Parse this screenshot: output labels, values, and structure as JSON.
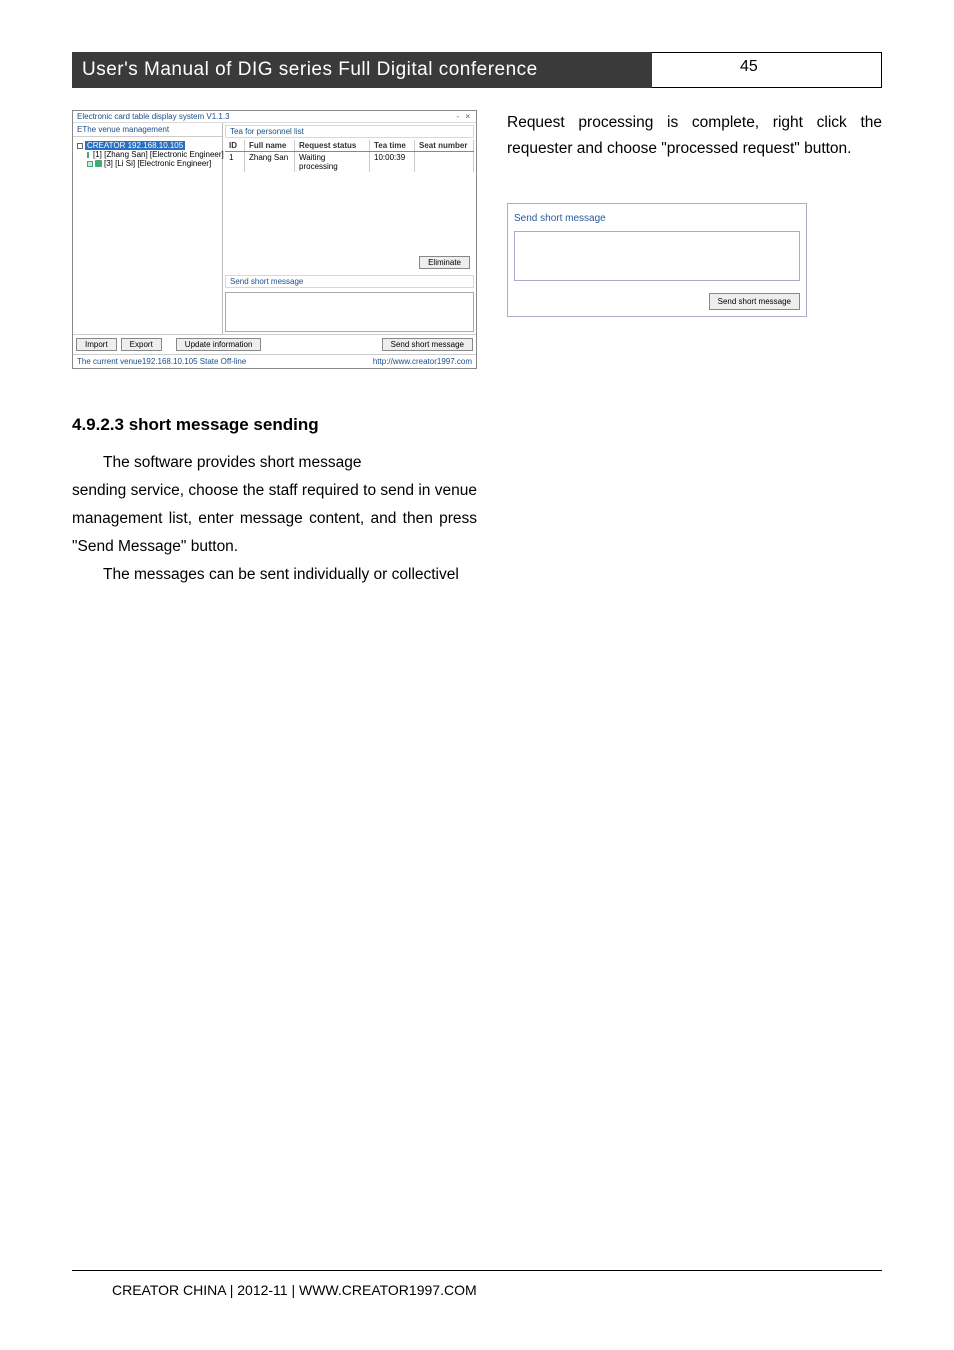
{
  "header": {
    "title": "User's  Manual  of  DIG  series  Full  Digital  conference",
    "page_number": "45"
  },
  "app_window": {
    "title": "Electronic card table display system V1.1.3",
    "tree_header": "EThe venue management",
    "tree": {
      "root_label": "CREATOR 192.168.10.105",
      "items": [
        {
          "label": "[1] [Zhang San] [Electronic Engineer]"
        },
        {
          "label": "[3] [Li Si] [Electronic Engineer]"
        }
      ]
    },
    "panel1_header": "Tea for personnel list",
    "grid_headers": {
      "id": "ID",
      "name": "Full name",
      "status": "Request status",
      "time": "Tea time",
      "seat": "Seat number"
    },
    "grid_rows": [
      {
        "id": "1",
        "name": "Zhang San",
        "status": "Waiting processing",
        "time": "10:00:39",
        "seat": ""
      }
    ],
    "eliminate_btn": "Eliminate",
    "panel2_header": "Send short message",
    "bottom": {
      "import": "Import",
      "export": "Export",
      "update": "Update information",
      "send": "Send short message"
    },
    "statusbar": {
      "left": "The current venue192.168.10.105    State  Off-line",
      "right": "http://www.creator1997.com"
    }
  },
  "right_col_paragraph": "Request processing is complete, right click the requester and choose \"processed request\" button.",
  "mini_panel": {
    "header": "Send short message",
    "send_btn": "Send short message"
  },
  "section_heading": "4.9.2.3   short message sending",
  "body_paragraphs": {
    "p1a": "The software provides short message",
    "p1b": "sending service, choose the staff required to send in venue management list, enter message content, and then press \"Send Message\" button.",
    "p2": "The messages can be sent individually or collectivel"
  },
  "footer": "CREATOR CHINA | 2012-11 |  WWW.CREATOR1997.COM"
}
